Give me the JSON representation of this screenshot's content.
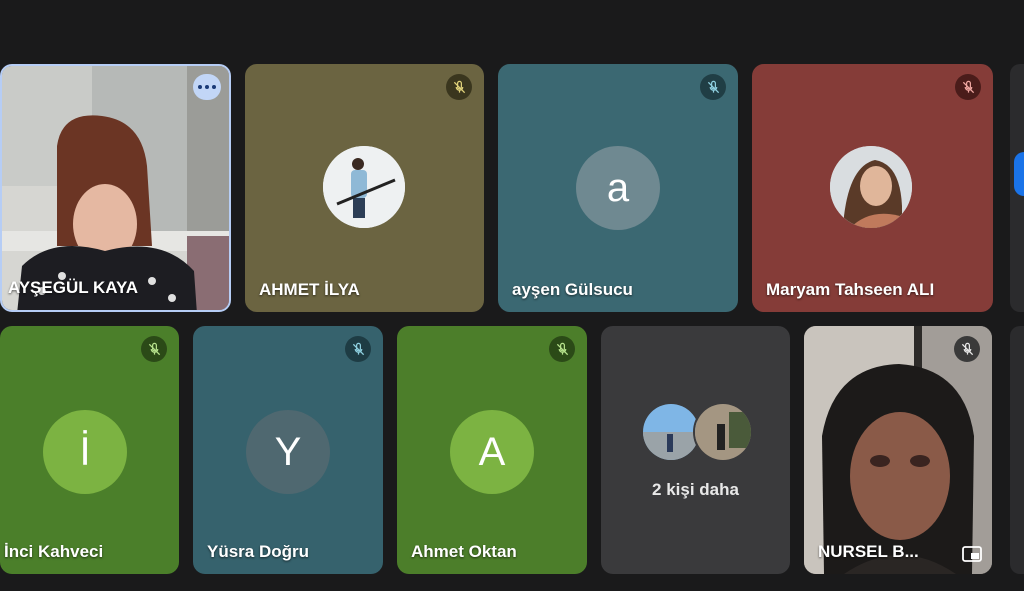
{
  "participants": [
    {
      "name": "AYŞEGÜL KAYA",
      "tile_color": "#4b4a46",
      "state": "speaking-video"
    },
    {
      "name": "AHMET İLYA",
      "tile_color": "#6b6441",
      "mute_color": "#3a361e",
      "avatar_type": "photo"
    },
    {
      "name": "ayşen Gülsucu",
      "tile_color": "#3b6872",
      "mute_color": "#203e45",
      "avatar_letter": "a",
      "avatar_color": "#6f8991"
    },
    {
      "name": "Maryam Tahseen ALI",
      "tile_color": "#853c38",
      "mute_color": "#4a1c1a",
      "avatar_type": "photo"
    },
    {
      "name": "İnci Kahveci",
      "tile_color": "#4b7f2a",
      "mute_color": "#2b4a17",
      "avatar_letter": "İ",
      "avatar_color": "#7cb342"
    },
    {
      "name": "Yüsra Doğru",
      "tile_color": "#36626d",
      "mute_color": "#1e3c44",
      "avatar_letter": "Y",
      "avatar_color": "#4f6870"
    },
    {
      "name": "Ahmet Oktan",
      "tile_color": "#4c7e2a",
      "mute_color": "#2b4a17",
      "avatar_letter": "A",
      "avatar_color": "#7cb342"
    },
    {
      "name": "NURSEL B...",
      "tile_color": "#5a534c",
      "mute_color": "#3a3a3a",
      "state": "video"
    }
  ],
  "more_tile": {
    "label": "2 kişi daha",
    "tile_color": "#3a3a3c"
  },
  "icons": {
    "mute": "mic-off-icon",
    "more_options": "more-options-icon",
    "pip": "picture-in-picture-icon"
  },
  "accent_color": "#b6cdf5"
}
